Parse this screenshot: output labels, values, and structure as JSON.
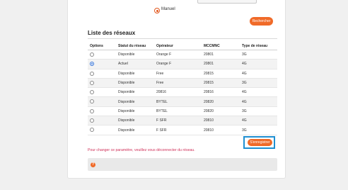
{
  "mode": {
    "manual_label": "Manuel"
  },
  "buttons": {
    "search_label": "Rechercher",
    "save_label": "S'enregistrer"
  },
  "networks": {
    "title": "Liste des réseaux",
    "columns": [
      "Options",
      "Statut du réseau",
      "Opérateur",
      "MCCMNC",
      "Type de réseau"
    ],
    "rows": [
      {
        "selected": false,
        "status": "Disponible",
        "operator": "Orange F",
        "mccmnc": "20801",
        "type": "3G"
      },
      {
        "selected": true,
        "status": "Actuel",
        "operator": "Orange F",
        "mccmnc": "20801",
        "type": "4G"
      },
      {
        "selected": false,
        "status": "Disponible",
        "operator": "Free",
        "mccmnc": "20815",
        "type": "4G"
      },
      {
        "selected": false,
        "status": "Disponible",
        "operator": "Free",
        "mccmnc": "20815",
        "type": "3G"
      },
      {
        "selected": false,
        "status": "Disponible",
        "operator": "20816",
        "mccmnc": "20816",
        "type": "4G"
      },
      {
        "selected": false,
        "status": "Disponible",
        "operator": "BYTEL",
        "mccmnc": "20820",
        "type": "4G"
      },
      {
        "selected": false,
        "status": "Disponible",
        "operator": "BYTEL",
        "mccmnc": "20820",
        "type": "3G"
      },
      {
        "selected": false,
        "status": "Disponible",
        "operator": "F SFR",
        "mccmnc": "20810",
        "type": "4G"
      },
      {
        "selected": false,
        "status": "Disponible",
        "operator": "F SFR",
        "mccmnc": "20810",
        "type": "3G"
      }
    ]
  },
  "warning": "Pour changer ce paramètre, veuillez vous déconnecter du réseau.",
  "info": {
    "icon": "question-icon",
    "glyph": "?"
  },
  "colors": {
    "accent": "#f06a28",
    "focus": "#1f8fd1",
    "warning": "#d0315a"
  }
}
